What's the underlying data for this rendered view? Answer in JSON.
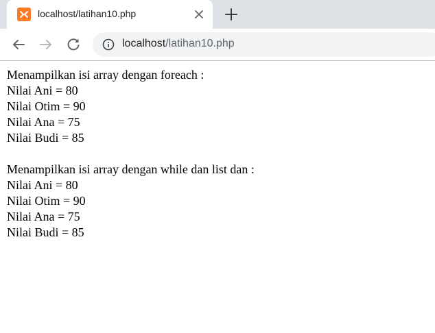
{
  "browser": {
    "tab_title": "localhost/latihan10.php",
    "favicon": "xampp-icon",
    "url_host": "localhost",
    "url_path": "/latihan10.php"
  },
  "page": {
    "section1": {
      "heading": "Menampilkan isi array dengan foreach :",
      "lines": [
        "Nilai Ani = 80",
        "Nilai Otim = 90",
        "Nilai Ana = 75",
        "Nilai Budi = 85"
      ]
    },
    "section2": {
      "heading": "Menampilkan isi array dengan while dan list dan :",
      "lines": [
        "Nilai Ani = 80",
        "Nilai Otim = 90",
        "Nilai Ana = 75",
        "Nilai Budi = 85"
      ]
    }
  },
  "colors": {
    "tabbar": "#dee1e6",
    "favicon": "#fb7a24"
  }
}
